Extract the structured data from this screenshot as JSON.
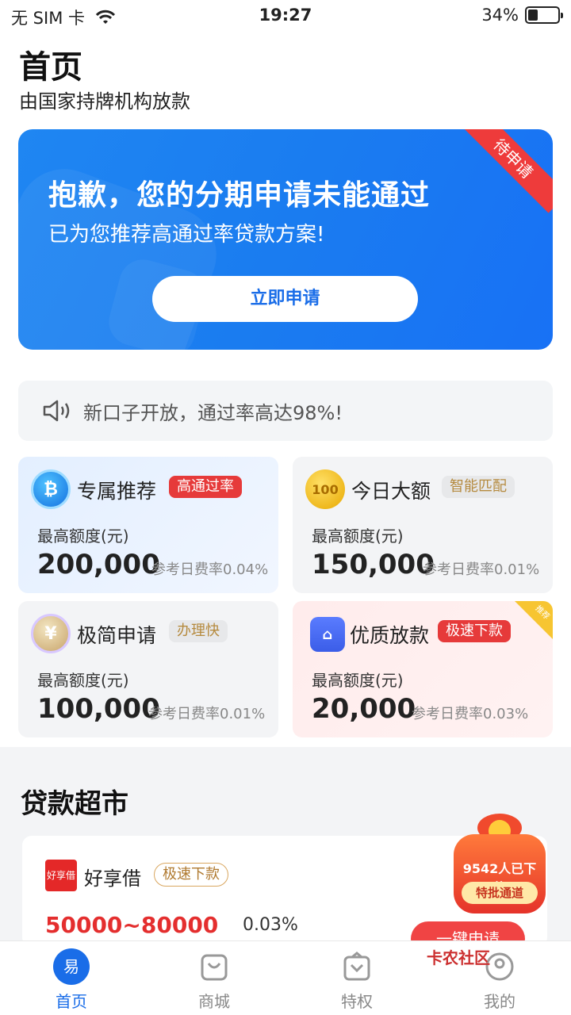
{
  "status": {
    "carrier": "无 SIM 卡",
    "time": "19:27",
    "battery": "34%",
    "battery_level": 0.34
  },
  "page": {
    "title": "首页",
    "subtitle": "由国家持牌机构放款"
  },
  "banner": {
    "title": "抱歉，您的分期申请未能通过",
    "desc": "已为您推荐高通过率贷款方案!",
    "button": "立即申请",
    "ribbon": "待申请"
  },
  "notice": {
    "text": "新口子开放，通过率高达98%!"
  },
  "cards": [
    {
      "title": "专属推荐",
      "tag": "高通过率",
      "max_label": "最高额度(元)",
      "amount": "200,000",
      "rate": "参考日费率0.04%",
      "icon": "bitcoin-icon"
    },
    {
      "title": "今日大额",
      "tag": "智能匹配",
      "max_label": "最高额度(元)",
      "amount": "150,000",
      "rate": "参考日费率0.01%",
      "icon": "gold-coin-icon"
    },
    {
      "title": "极简申请",
      "tag": "办理快",
      "max_label": "最高额度(元)",
      "amount": "100,000",
      "rate": "参考日费率0.01%",
      "icon": "yuan-coin-icon"
    },
    {
      "title": "优质放款",
      "tag": "极速下款",
      "max_label": "最高额度(元)",
      "amount": "20,000",
      "rate": "参考日费率0.03%",
      "icon": "loan-app-icon",
      "corner": "推荐"
    }
  ],
  "market": {
    "title": "贷款超市",
    "item": {
      "logo": "好享借",
      "name": "好享借",
      "tag": "极速下款",
      "range": "50000~80000",
      "rate": "0.03%",
      "apply": "一键申请"
    }
  },
  "bag": {
    "count": "9542人已下款",
    "button": "特批通道"
  },
  "watermark": "卡农社区",
  "tabs": [
    {
      "label": "首页",
      "icon": "home-icon"
    },
    {
      "label": "商城",
      "icon": "shopping-bag-icon"
    },
    {
      "label": "特权",
      "icon": "privilege-icon"
    },
    {
      "label": "我的",
      "icon": "profile-icon"
    }
  ]
}
